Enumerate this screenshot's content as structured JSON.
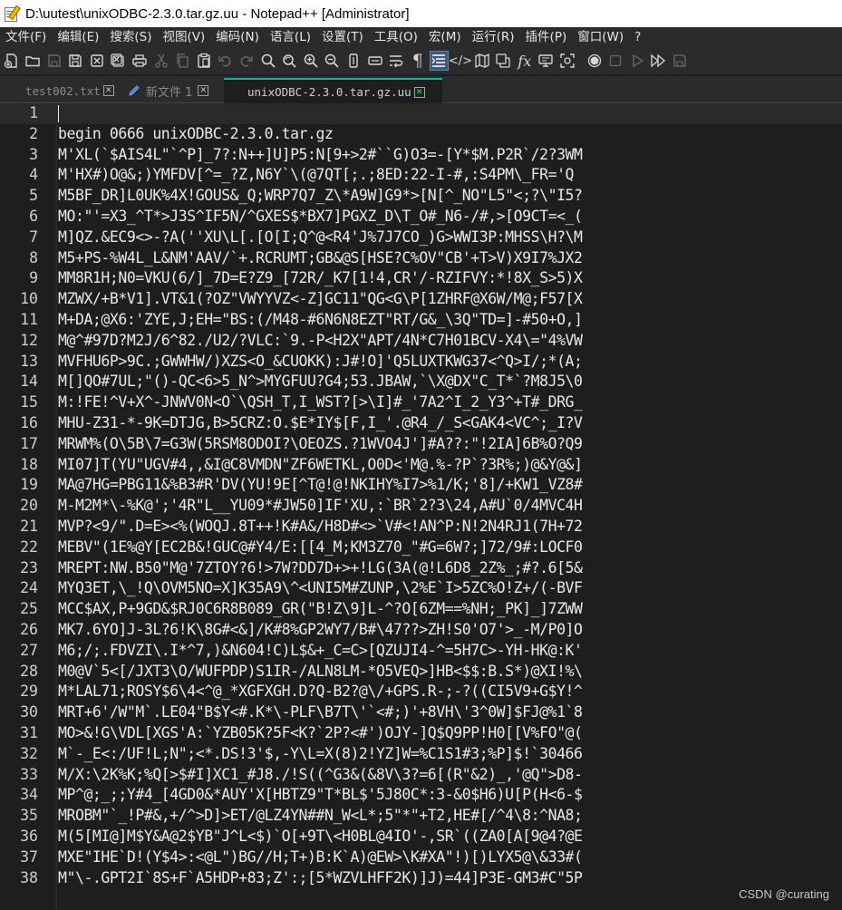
{
  "window": {
    "title": "D:\\uutest\\unixODBC-2.3.0.tar.gz.uu - Notepad++ [Administrator]"
  },
  "menu": {
    "items": [
      "文件(F)",
      "编辑(E)",
      "搜索(S)",
      "视图(V)",
      "编码(N)",
      "语言(L)",
      "设置(T)",
      "工具(O)",
      "宏(M)",
      "运行(R)",
      "插件(P)",
      "窗口(W)",
      "?"
    ]
  },
  "toolbar": {
    "icons": [
      "new-file-icon",
      "open-folder-icon",
      "save-icon",
      "save-all-icon",
      "close-icon",
      "close-all-icon",
      "print-icon",
      "cut-icon",
      "copy-icon",
      "paste-icon",
      "undo-icon",
      "redo-icon",
      "find-icon",
      "replace-icon",
      "zoom-in-icon",
      "zoom-out-icon",
      "sync-vertical-icon",
      "sync-horizontal-icon",
      "word-wrap-icon",
      "show-all-chars-icon",
      "indent-guide-icon",
      "xml-tag-icon",
      "document-map-icon",
      "clone-icon",
      "function-list-icon",
      "monitor-icon",
      "screenshot-icon",
      "record-macro-icon",
      "stop-macro-icon",
      "play-macro-icon",
      "run-macro-multiple-icon",
      "save-macro-icon"
    ]
  },
  "tabs": [
    {
      "label": "test002.txt",
      "active": false,
      "close": "✕"
    },
    {
      "label": "新文件 1",
      "active": false,
      "close": "✕"
    },
    {
      "label": "unixODBC-2.3.0.tar.gz.uu",
      "active": true,
      "close": "✕"
    }
  ],
  "editor": {
    "lines": [
      {
        "n": "1",
        "text": ""
      },
      {
        "n": "2",
        "text": "begin 0666 unixODBC-2.3.0.tar.gz"
      },
      {
        "n": "3",
        "text": "M'XL(`$AIS4L\"`^P]_7?:N++]U]P5:N[9+>2#``G)O3=-[Y*$M.P2R`/2?3WM"
      },
      {
        "n": "4",
        "text": "M'HX#)O@&;)YMFDV[^=_?Z,N6Y`\\(@7QT[;.;8ED:22-I-#,:S4PM\\_FR='Q"
      },
      {
        "n": "5",
        "text": "M5BF_DR]L0UK%4X!GOUS&_Q;WRP7Q7_Z\\*A9W]G9*>[N[^_NO\"L5\"<;?\\\"I5?"
      },
      {
        "n": "6",
        "text": "MO:\"'=X3_^T*>J3S^IF5N/^GXES$*BX7]PGXZ_D\\T_O#_N6-/#,>[O9CT=<_("
      },
      {
        "n": "7",
        "text": "M]QZ.&EC9<>-?A(''XU\\L[.[O[I;Q^@<R4'J%7J7CO_)G>WWI3P:MHSS\\H?\\M"
      },
      {
        "n": "8",
        "text": "M5+PS-%W4L_L&NM'AAV/`+.RCRUMT;GB&@S[HSE?C%OV\"CB'+T>V)X9I7%JX2"
      },
      {
        "n": "9",
        "text": "MM8R1H;N0=VKU(6/]_7D=E?Z9_[72R/_K7[1!4,CR'/-RZIFVY:*!8X_S>5)X"
      },
      {
        "n": "10",
        "text": "MZWX/+B*V1].VT&1(?OZ\"VWYYVZ<-Z]GC11\"QG<G\\P[1ZHRF@X6W/M@;F57[X"
      },
      {
        "n": "11",
        "text": "M+DA;@X6:'ZYE,J;EH=\"BS:(/M48-#6N6N8EZT\"RT/G&_\\3Q\"TD=]-#50+O,]"
      },
      {
        "n": "12",
        "text": "M@^#97D?M2J/6^82./U2/?VLC:`9.-P<H2X\"APT/4N*C7H01BCV-X4\\=\"4%VW"
      },
      {
        "n": "13",
        "text": "MVFHU6P>9C.;GWWHW/)XZS<O_&CUOKK):J#!O]'Q5LUXTKWG37<^Q>I/;*(A;"
      },
      {
        "n": "14",
        "text": "M[]QO#7UL;\"()-QC<6>5_N^>MYGFUU?G4;53.JBAW,`\\X@DX\"C_T*`?M8J5\\0"
      },
      {
        "n": "15",
        "text": "M:!FE!^V+X^-JNWV0N<O`\\QSH_T,I_WST?[>\\I]#_'7A2^I_2_Y3^+T#_DRG_"
      },
      {
        "n": "16",
        "text": "MHU-Z31-*-9K=DTJG,B>5CRZ:O.$E*IY$[F,I_'.@R4_/_S<GAK4<VC^;_I?V"
      },
      {
        "n": "17",
        "text": "MRWM%(O\\5B\\7=G3W(5RSM8ODOI?\\OEOZS.?1WVO4J']#A??:\"!2IA]6B%O?Q9"
      },
      {
        "n": "18",
        "text": "MI07]T(YU\"UGV#4,,&I@C8VMDN\"ZF6WETKL,O0D<'M@.%-?P`?3R%;)@&Y@&]"
      },
      {
        "n": "19",
        "text": "MA@7HG=PBG11&%B3#R'DV(YU!9E[^T@!@!NKIHY%I7>%1/K;'8]/+KW1_VZ8#"
      },
      {
        "n": "20",
        "text": "M-M2M*\\-%K@';'4R\"L__YU09*#JW50]IF'XU,:`BR`2?3\\24,A#U`0/4MVC4H"
      },
      {
        "n": "21",
        "text": "MVP?<9/\".D=E><%(WOQJ.8T++!K#A&/H8D#<>`V#<!AN^P:N!2N4RJ1(7H+72"
      },
      {
        "n": "22",
        "text": "MEBV\"(1E%@Y[EC2B&!GUC@#Y4/E:[[4_M;KM3Z70_\"#G=6W?;]72/9#:LOCF0"
      },
      {
        "n": "23",
        "text": "MREPT:NW.B50\"M@'7ZTOY?6!>7W?DD7D+>+!LG(3A(@!L6D8_2Z%_;#?.6[5&"
      },
      {
        "n": "24",
        "text": "MYQ3ET,\\_!Q\\OVM5NO=X]K35A9\\^<UNI5M#ZUNP,\\2%E`I>5ZC%O!Z+/(-BVF"
      },
      {
        "n": "25",
        "text": "MCC$AX,P+9GD&$RJ0C6R8B089_GR(\"B!Z\\9]L-^?O[6ZM==%NH;_PK]_]7ZWW"
      },
      {
        "n": "26",
        "text": "MK7.6YO]J-3L?6!K\\8G#<&]/K#8%GP2WY7/B#\\47??>ZH!S0'O7'>_-M/P0]O"
      },
      {
        "n": "27",
        "text": "M6;/;.FDVZI\\.I*^7,)&N604!C)L$&+_C=C>[QZUJI4-^=5H7C>-YH-HK@:K'"
      },
      {
        "n": "28",
        "text": "M0@V`5<[/JXT3\\O/WUFPDP)S1IR-/ALN8LM-*O5VEQ>]HB<$$:B.S*)@XI!%\\"
      },
      {
        "n": "29",
        "text": "M*LAL71;ROSY$6\\4<^@_*XGFXGH.D?Q-B2?@\\/+GPS.R-;-?((CI5V9+G$Y!^"
      },
      {
        "n": "30",
        "text": "MRT+6'/W\"M`.LE04\"B$Y<#.K*\\-PLF\\B7T\\'`<#;)'+8VH\\'3^0W]$FJ@%1`8"
      },
      {
        "n": "31",
        "text": "MO>&!G\\VDL[XGS'A:`YZB05K?5F<K?`2P?<#')OJY-]Q$Q9PP!H0[[V%FO\"@("
      },
      {
        "n": "32",
        "text": "M`-_E<:/UF!L;N\";<*.DS!3'$,-Y\\L=X(8)2!YZ]W=%C1S1#3;%P]$!`30466"
      },
      {
        "n": "33",
        "text": "M/X:\\2K%K;%Q[>$#I]XC1_#J8./!S((^G3&(&8V\\3?=6[(R\"&2)_,'@Q\">D8-"
      },
      {
        "n": "34",
        "text": "MP^@;_;;Y#4_[4GD0&*AUY'X[HBTZ9\"T*BL$'5J80C*:3-&0$H6)U[P(H<6-$"
      },
      {
        "n": "35",
        "text": "MROBM\"`_!P#&,+/^>D]>ET/@LZ4YN##N_W<L*;5\"*\"+T2,HE#[/^4\\8:^NA8;"
      },
      {
        "n": "36",
        "text": "M(5[MI@]M$Y&A@2$YB\"J^L<$)`O[+9T\\<H0BL@4IO'-,SR`((ZA0[A[9@4?@E"
      },
      {
        "n": "37",
        "text": "MXE\"IHE`D!(Y$4>:<@L\")BG//H;T+)B:K`A)@EW>\\K#XA\"!)[)LYX5@\\&33#("
      },
      {
        "n": "38",
        "text": "M\"\\-.GPT2I`8S+F`A5HDP+83;Z':;[5*WZVLHFF2K)]J)=44]P3E-GM3#C\"5P"
      }
    ]
  },
  "watermark": "CSDN @curating"
}
